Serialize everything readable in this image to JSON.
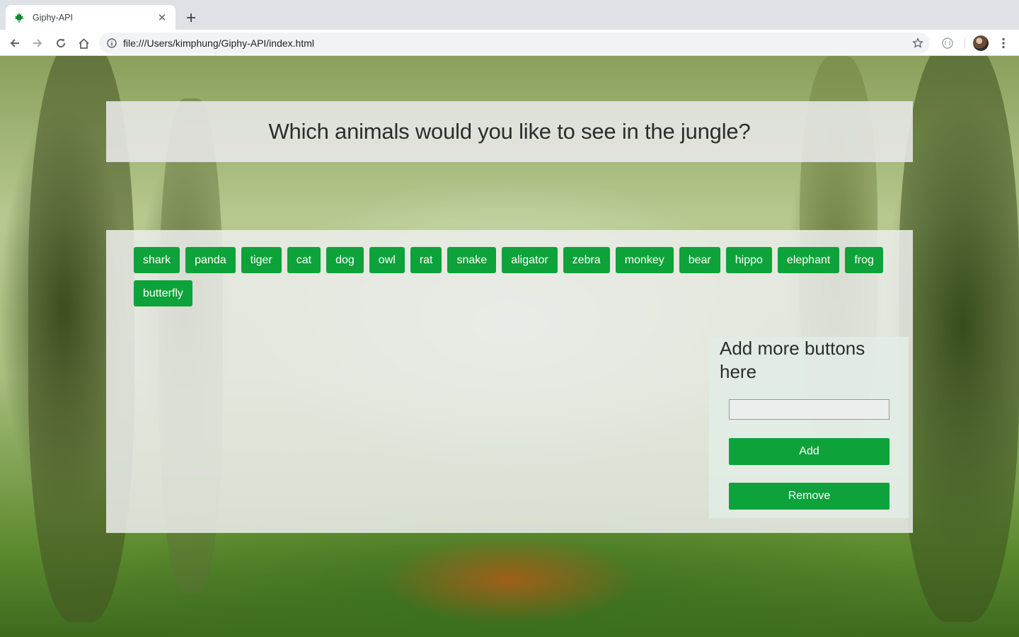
{
  "browser": {
    "tab_title": "Giphy-API",
    "url": "file:///Users/kimphung/Giphy-API/index.html"
  },
  "page": {
    "heading": "Which animals would you like to see in the jungle?",
    "animals": [
      "shark",
      "panda",
      "tiger",
      "cat",
      "dog",
      "owl",
      "rat",
      "snake",
      "aligator",
      "zebra",
      "monkey",
      "bear",
      "hippo",
      "elephant",
      "frog",
      "butterfly"
    ],
    "add_panel": {
      "title": "Add more buttons here",
      "input_value": "",
      "add_label": "Add",
      "remove_label": "Remove"
    }
  },
  "colors": {
    "button_green": "#0ea23a",
    "panel_bg": "rgba(236,238,236,0.86)"
  }
}
